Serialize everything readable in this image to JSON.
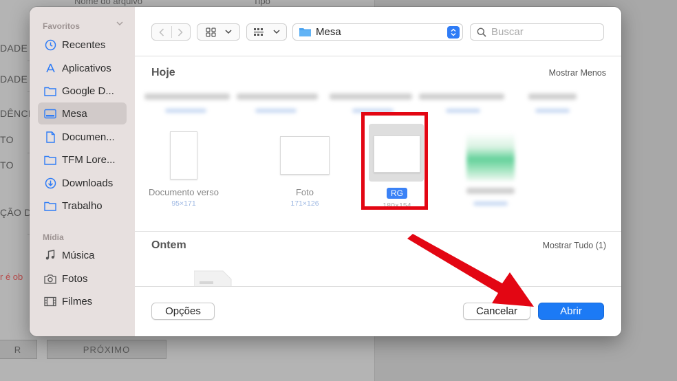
{
  "background": {
    "labels": [
      "DADE",
      "DADE",
      "DÊNCIA",
      "TO",
      "TO",
      "ÇÃO D"
    ],
    "top_texts": [
      "Nome do arquivo",
      "Tipo"
    ],
    "error_text": "r é ob",
    "back_button": "R",
    "next_button": "PRÓXIMO"
  },
  "sidebar": {
    "favorites_title": "Favoritos",
    "media_title": "Mídia",
    "favorites": [
      {
        "label": "Recentes",
        "icon": "clock-icon"
      },
      {
        "label": "Aplicativos",
        "icon": "applications-icon"
      },
      {
        "label": "Google D...",
        "icon": "folder-icon"
      },
      {
        "label": "Mesa",
        "icon": "desktop-icon",
        "selected": true
      },
      {
        "label": "Documen...",
        "icon": "document-icon"
      },
      {
        "label": "TFM Lore...",
        "icon": "folder-icon"
      },
      {
        "label": "Downloads",
        "icon": "download-icon"
      },
      {
        "label": "Trabalho",
        "icon": "folder-icon"
      }
    ],
    "media": [
      {
        "label": "Música",
        "icon": "music-icon"
      },
      {
        "label": "Fotos",
        "icon": "camera-icon"
      },
      {
        "label": "Filmes",
        "icon": "film-icon"
      }
    ]
  },
  "toolbar": {
    "location": "Mesa",
    "search_placeholder": "Buscar"
  },
  "sections": {
    "today": {
      "title": "Hoje",
      "action": "Mostrar Menos"
    },
    "yesterday": {
      "title": "Ontem",
      "action": "Mostrar Tudo (1)"
    }
  },
  "files": [
    {
      "name": "Documento verso",
      "dimensions": "95×171"
    },
    {
      "name": "Foto",
      "dimensions": "171×126"
    },
    {
      "name": "RG",
      "dimensions": "180×154",
      "selected": true
    }
  ],
  "buttons": {
    "options": "Opções",
    "cancel": "Cancelar",
    "open": "Abrir"
  },
  "colors": {
    "accent": "#1c7af5",
    "highlight": "#e30613",
    "sidebar": "#e7e0df"
  }
}
